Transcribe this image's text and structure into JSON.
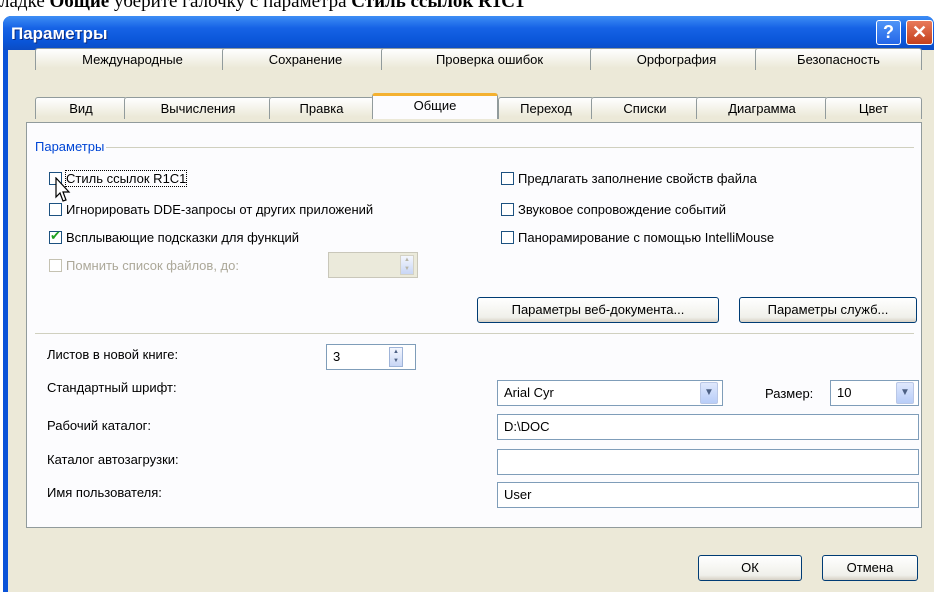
{
  "caption": {
    "prefix": "ладке ",
    "tab_bold": "Общие",
    "middle": " уберите галочку с параметра ",
    "param_bold": "Стиль ссылок R1C1"
  },
  "window": {
    "title": "Параметры",
    "help_label": "?",
    "close_label": "✕"
  },
  "tabs_back": [
    "Международные",
    "Сохранение",
    "Проверка ошибок",
    "Орфография",
    "Безопасность"
  ],
  "tabs_front": [
    "Вид",
    "Вычисления",
    "Правка",
    "Общие",
    "Переход",
    "Списки",
    "Диаграмма",
    "Цвет"
  ],
  "active_tab": "Общие",
  "group": {
    "label": "Параметры"
  },
  "options_left": [
    {
      "label": "Стиль ссылок R1C1",
      "checked": false,
      "enabled": true
    },
    {
      "label": "Игнорировать DDE-запросы от других приложений",
      "checked": false,
      "enabled": true
    },
    {
      "label": "Всплывающие подсказки для функций",
      "checked": true,
      "enabled": true
    },
    {
      "label": "Помнить список файлов, до:",
      "checked": false,
      "enabled": false
    }
  ],
  "options_right": [
    {
      "label": "Предлагать заполнение свойств файла",
      "checked": false
    },
    {
      "label": "Звуковое сопровождение событий",
      "checked": false
    },
    {
      "label": "Панорамирование с помощью IntelliMouse",
      "checked": false
    }
  ],
  "buttons": {
    "web_options": "Параметры веб-документа...",
    "service_options": "Параметры служб...",
    "ok": "ОК",
    "cancel": "Отмена"
  },
  "fields": {
    "sheets_label": "Листов в новой книге:",
    "sheets_value": "3",
    "font_label": "Стандартный шрифт:",
    "font_value": "Arial Cyr",
    "size_label": "Размер:",
    "size_value": "10",
    "workdir_label": "Рабочий каталог:",
    "workdir_value": "D:\\DOC",
    "autoload_label": "Каталог автозагрузки:",
    "autoload_value": "",
    "username_label": "Имя пользователя:",
    "username_value": "User"
  },
  "icons": {
    "help": "question-mark-icon",
    "close": "close-x-icon",
    "spin": "spinner-arrows-icon",
    "dropdown": "chevron-down-icon",
    "cursor": "mouse-pointer-icon"
  }
}
